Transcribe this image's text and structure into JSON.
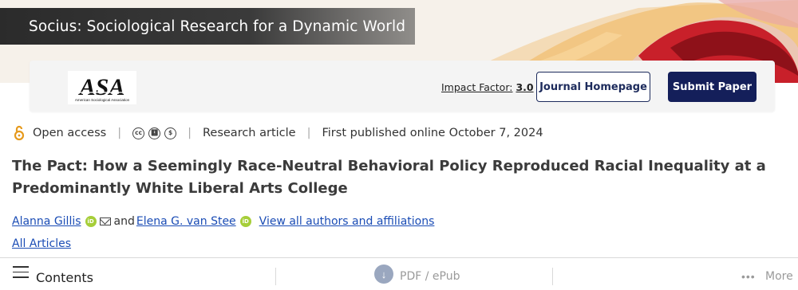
{
  "banner": {
    "journal_title": "Socius: Sociological Research for a Dynamic World"
  },
  "logo": {
    "text": "ASA",
    "subtext": "American Sociological Association"
  },
  "impact_factor": {
    "label": "Impact Factor:",
    "value": "3.0"
  },
  "buttons": {
    "journal_homepage": "Journal Homepage",
    "submit_paper": "Submit Paper"
  },
  "meta": {
    "open_access": "Open access",
    "license_icons": [
      "cc-icon",
      "by-icon",
      "nc-icon"
    ],
    "article_type": "Research article",
    "published": "First published online October 7, 2024"
  },
  "article": {
    "title": "The Pact: How a Seemingly Race-Neutral Behavioral Policy Reproduced Racial Inequality at a Predominantly White Liberal Arts College"
  },
  "authors": {
    "author1": "Alanna Gillis",
    "conjunction": "and",
    "author2": "Elena G. van Stee",
    "view_all": "View all authors and affiliations"
  },
  "all_articles": "All Articles",
  "toolbar": {
    "contents": "Contents",
    "pdf": "PDF / ePub",
    "more": "More"
  },
  "colors": {
    "navy": "#141f5a",
    "link": "#1a4cb5",
    "orcid": "#a6ce39",
    "oa": "#e69a1d"
  }
}
